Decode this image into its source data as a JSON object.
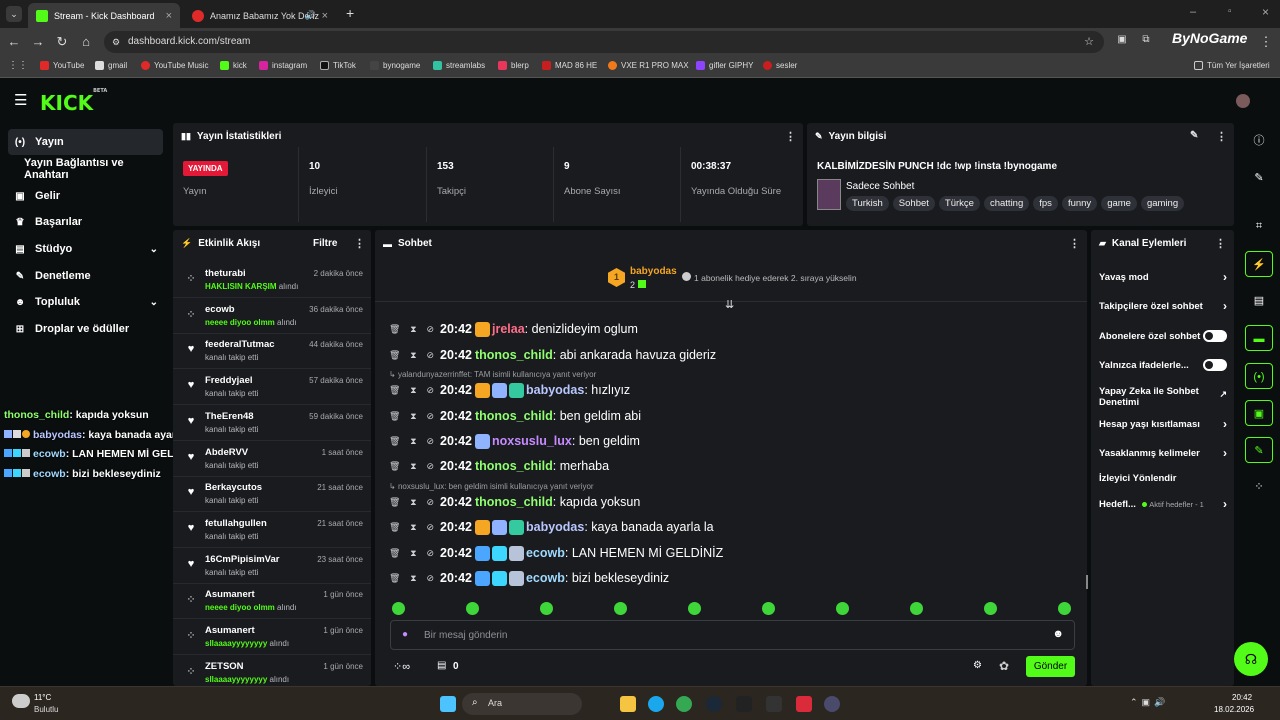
{
  "browser": {
    "tabs": [
      {
        "title": "Stream - Kick Dashboard",
        "active": true
      },
      {
        "title": "Anamız Babamız Yok Deriz",
        "active": false
      }
    ],
    "new_tab": "+",
    "url": "dashboard.kick.com/stream",
    "profile": "ByNoGame",
    "bookmarks": [
      "YouTube",
      "gmail",
      "YouTube Music",
      "kick",
      "instagram",
      "TikTok",
      "bynogame",
      "streamlabs",
      "blerp",
      "MAD 86 HE",
      "VXE R1 PRO MAX",
      "gifler GIPHY",
      "sesler"
    ],
    "all_bookmarks": "Tüm Yer İşaretleri"
  },
  "app": {
    "logo": "KICK",
    "logo_sup": "BETA"
  },
  "sidebar": {
    "items": [
      {
        "label": "Yayın",
        "icon": "broadcast-icon"
      },
      {
        "label": "Yayın Bağlantısı ve Anahtarı",
        "icon": ""
      },
      {
        "label": "Gelir",
        "icon": "revenue-icon"
      },
      {
        "label": "Başarılar",
        "icon": "trophy-icon"
      },
      {
        "label": "Stüdyo",
        "icon": "studio-icon"
      },
      {
        "label": "Denetleme",
        "icon": "wrench-icon"
      },
      {
        "label": "Topluluk",
        "icon": "community-icon"
      },
      {
        "label": "Droplar ve ödüller",
        "icon": "gift-icon"
      }
    ]
  },
  "overlay_chat": [
    {
      "user": "thonos_child",
      "text": ": kapıda yoksun"
    },
    {
      "user": "babyodas",
      "text": ": kaya banada ayarla la"
    },
    {
      "user": "ecowb",
      "text": ": LAN HEMEN Mİ GELDİNİZ"
    },
    {
      "user": "ecowb",
      "text": ": bizi bekleseydiniz"
    }
  ],
  "stats": {
    "title": "Yayın İstatistikleri",
    "live_badge": "YAYINDA",
    "live_label": "Yayın",
    "items": [
      {
        "value": "10",
        "label": "İzleyici"
      },
      {
        "value": "153",
        "label": "Takipçi"
      },
      {
        "value": "9",
        "label": "Abone Sayısı"
      },
      {
        "value": "00:38:37",
        "label": "Yayında Olduğu Süre"
      }
    ]
  },
  "info": {
    "title": "Yayın bilgisi",
    "stream_title": "KALBİMİZDESİN PUNCH !dc !wp !insta !bynogame",
    "category": "Sadece Sohbet",
    "tags": [
      "Turkish",
      "Sohbet",
      "Türkçe",
      "chatting",
      "fps",
      "funny",
      "game",
      "gaming"
    ]
  },
  "activity": {
    "title": "Etkinlik Akışı",
    "filter": "Filtre",
    "items": [
      {
        "name": "theturabi",
        "desc_b": "HAKLISIN KARŞIM",
        "desc": " alındı",
        "time": "2 dakika önce",
        "icon": "gift-icon"
      },
      {
        "name": "ecowb",
        "desc_b": "neeee diyoo olmm",
        "desc": " alındı",
        "time": "36 dakika önce",
        "icon": "gift-icon"
      },
      {
        "name": "feederalTutmac",
        "desc_b": "",
        "desc": "kanalı takip etti",
        "time": "44 dakika önce",
        "icon": "heart-icon"
      },
      {
        "name": "Freddyjael",
        "desc_b": "",
        "desc": "kanalı takip etti",
        "time": "57 dakika önce",
        "icon": "heart-icon"
      },
      {
        "name": "TheEren48",
        "desc_b": "",
        "desc": "kanalı takip etti",
        "time": "59 dakika önce",
        "icon": "heart-icon"
      },
      {
        "name": "AbdeRVV",
        "desc_b": "",
        "desc": "kanalı takip etti",
        "time": "1 saat önce",
        "icon": "heart-icon"
      },
      {
        "name": "Berkaycutos",
        "desc_b": "",
        "desc": "kanalı takip etti",
        "time": "21 saat önce",
        "icon": "heart-icon"
      },
      {
        "name": "fetullahgullen",
        "desc_b": "",
        "desc": "kanalı takip etti",
        "time": "21 saat önce",
        "icon": "heart-icon"
      },
      {
        "name": "16CmPipisimVar",
        "desc_b": "",
        "desc": "kanalı takip etti",
        "time": "23 saat önce",
        "icon": "heart-icon"
      },
      {
        "name": "Asumanert",
        "desc_b": "neeee diyoo olmm",
        "desc": " alındı",
        "time": "1 gün önce",
        "icon": "gift-icon"
      },
      {
        "name": "Asumanert",
        "desc_b": "sllaaaayyyyyyyy",
        "desc": " alındı",
        "time": "1 gün önce",
        "icon": "gift-icon"
      },
      {
        "name": "ZETSON",
        "desc_b": "sllaaaayyyyyyyy",
        "desc": " alındı",
        "time": "1 gün önce",
        "icon": "gift-icon"
      }
    ]
  },
  "chat": {
    "title": "Sohbet",
    "pinned_user": "babyodas",
    "pinned_count": "2",
    "pinned_text": "1 abonelik hediye ederek 2. sıraya yükselin",
    "messages": [
      {
        "time": "20:42",
        "user": "jrelaa",
        "text": ": denizlideyim oglum",
        "color": "#ff6f8a"
      },
      {
        "time": "20:42",
        "user": "thonos_child",
        "text": ": abi ankarada havuza gideriz",
        "color": "#8fff6f"
      },
      {
        "reply": "yalandunyazerrinffet: TAM isimli kullanıcıya yanıt veriyor"
      },
      {
        "time": "20:42",
        "user": "babyodas",
        "text": ": hızlıyız",
        "color": "#b9c7ff"
      },
      {
        "time": "20:42",
        "user": "thonos_child",
        "text": ": ben geldim abi",
        "color": "#8fff6f"
      },
      {
        "time": "20:42",
        "user": "noxsuslu_lux",
        "text": ": ben geldim",
        "color": "#c58bff"
      },
      {
        "time": "20:42",
        "user": "thonos_child",
        "text": ": merhaba",
        "color": "#8fff6f"
      },
      {
        "reply": "noxsuslu_lux: ben geldim isimli kullanıcıya yanıt veriyor"
      },
      {
        "time": "20:42",
        "user": "thonos_child",
        "text": ": kapıda yoksun",
        "color": "#8fff6f"
      },
      {
        "time": "20:42",
        "user": "babyodas",
        "text": ": kaya banada ayarla la",
        "color": "#b9c7ff"
      },
      {
        "time": "20:42",
        "user": "ecowb",
        "text": ": LAN HEMEN Mİ GELDİNİZ",
        "color": "#9fd9ff"
      },
      {
        "time": "20:42",
        "user": "ecowb",
        "text": ": bizi bekleseydiniz",
        "color": "#9fd9ff"
      }
    ],
    "input_placeholder": "Bir mesaj gönderin",
    "points": "0",
    "send": "Gönder"
  },
  "actions": {
    "title": "Kanal Eylemleri",
    "items": [
      {
        "label": "Yavaş mod",
        "kind": "chevron"
      },
      {
        "label": "Takipçilere özel sohbet",
        "kind": "chevron"
      },
      {
        "label": "Abonelere özel sohbet",
        "kind": "toggle"
      },
      {
        "label": "Yalnızca ifadelerle...",
        "kind": "toggle"
      },
      {
        "label": "Yapay Zeka ile Sohbet Denetimi",
        "kind": "external"
      },
      {
        "label": "Hesap yaşı kısıtlaması",
        "kind": "chevron"
      },
      {
        "label": "Yasaklanmış kelimeler",
        "kind": "chevron"
      },
      {
        "label": "İzleyici Yönlendir",
        "kind": "none"
      },
      {
        "label": "Hedefl...",
        "kind": "chevron",
        "extra": "Aktif hedefler - 1"
      }
    ]
  },
  "taskbar": {
    "weather_temp": "11°C",
    "weather_desc": "Bulutlu",
    "search": "Ara",
    "time": "20:42",
    "date": "18.02.2026"
  }
}
